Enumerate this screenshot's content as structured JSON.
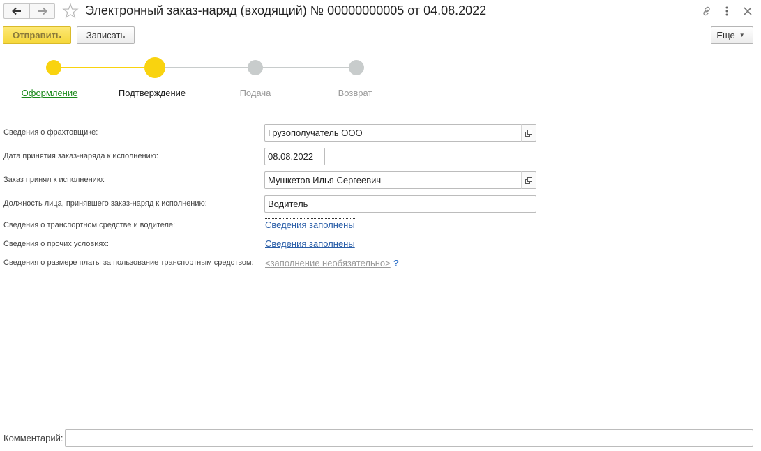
{
  "window": {
    "title": "Электронный заказ-наряд (входящий) № 00000000005 от 04.08.2022"
  },
  "toolbar": {
    "send_label": "Отправить",
    "save_label": "Записать",
    "more_label": "Еще"
  },
  "stepper": {
    "steps": [
      {
        "label": "Оформление",
        "state": "done"
      },
      {
        "label": "Подтверждение",
        "state": "current"
      },
      {
        "label": "Подача",
        "state": "future"
      },
      {
        "label": "Возврат",
        "state": "future"
      }
    ],
    "colors": {
      "active": "#f9d30f",
      "inactive": "#c8cccc"
    }
  },
  "form": {
    "carrier": {
      "label": "Сведения о фрахтовщике:",
      "value": "Грузополучатель ООО"
    },
    "accept_date": {
      "label": "Дата принятия заказ-наряда к исполнению:",
      "value": "08.08.2022"
    },
    "accepted_by": {
      "label": "Заказ принял к исполнению:",
      "value": "Мушкетов Илья Сергеевич"
    },
    "position": {
      "label": "Должность лица, принявшего заказ-наряд к исполнению:",
      "value": "Водитель"
    },
    "vehicle_driver": {
      "label": "Сведения о транспортном средстве и водителе:",
      "link": "Сведения заполнены"
    },
    "other_conditions": {
      "label": "Сведения о прочих условиях:",
      "link": "Сведения заполнены"
    },
    "payment": {
      "label": "Сведения о размере платы за пользование транспортным средством:",
      "link": "<заполнение необязательно>",
      "help": "?"
    }
  },
  "comment": {
    "label": "Комментарий:",
    "value": ""
  },
  "icons": {
    "back": "arrow-left-icon",
    "forward": "arrow-right-icon",
    "favorite": "star-icon",
    "link": "link-icon",
    "more": "kebab-icon",
    "close": "close-icon",
    "open": "open-in-window-icon"
  }
}
